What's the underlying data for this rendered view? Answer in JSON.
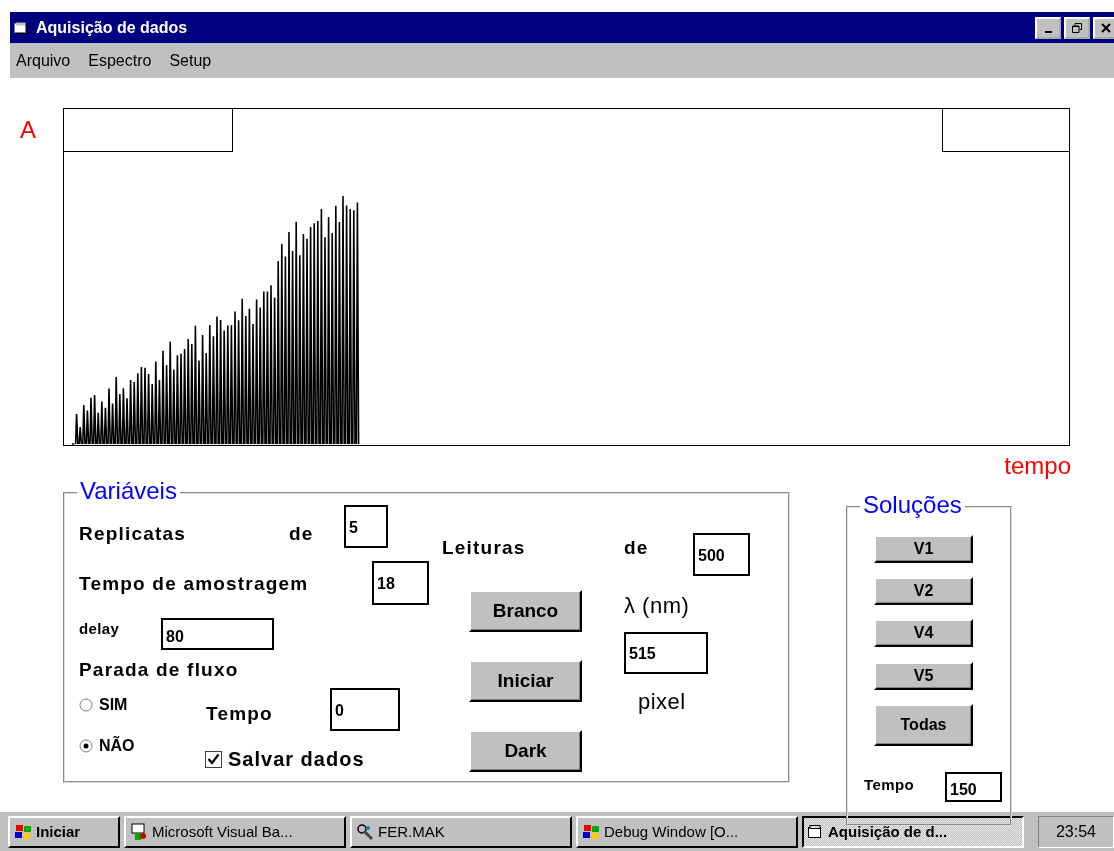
{
  "window": {
    "title": "Aquisição de dados"
  },
  "menu": [
    {
      "label": "Arquivo"
    },
    {
      "label": "Espectro"
    },
    {
      "label": "Setup"
    }
  ],
  "plot": {
    "y_label": "A",
    "x_label": "tempo"
  },
  "variables": {
    "title": "Variáveis",
    "replicates": {
      "label": "Replicatas",
      "of_label": "de",
      "value": "5"
    },
    "readings": {
      "label": "Leituras",
      "of_label": "de",
      "value": "500"
    },
    "sampling_time": {
      "label": "Tempo de amostragem",
      "value": "18"
    },
    "delay": {
      "label": "delay",
      "value": "80"
    },
    "flow_stop": {
      "label": "Parada de fluxo",
      "options": [
        {
          "label": "SIM",
          "selected": false
        },
        {
          "label": "NÃO",
          "selected": true
        }
      ],
      "time_label": "Tempo",
      "time_value": "0"
    },
    "save_data": {
      "label": "Salvar dados",
      "checked": true
    },
    "buttons": [
      "Branco",
      "Iniciar",
      "Dark"
    ],
    "wavelength": {
      "label": "λ (nm)",
      "value": "515",
      "unit": "pixel"
    }
  },
  "solutions": {
    "title": "Soluções",
    "buttons": [
      "V1",
      "V2",
      "V4",
      "V5",
      "Todas"
    ],
    "time_label": "Tempo",
    "time_value": "150"
  },
  "taskbar": {
    "start": "Iniciar",
    "tasks": [
      {
        "label": "Microsoft Visual Ba...",
        "selected": false,
        "kind": "vb"
      },
      {
        "label": "FER.MAK",
        "selected": false,
        "kind": "make"
      },
      {
        "label": "Debug Window [O...",
        "selected": false,
        "kind": "windows"
      },
      {
        "label": "Aquisição de d...",
        "selected": true,
        "kind": "form"
      }
    ],
    "clock": "23:54"
  }
}
